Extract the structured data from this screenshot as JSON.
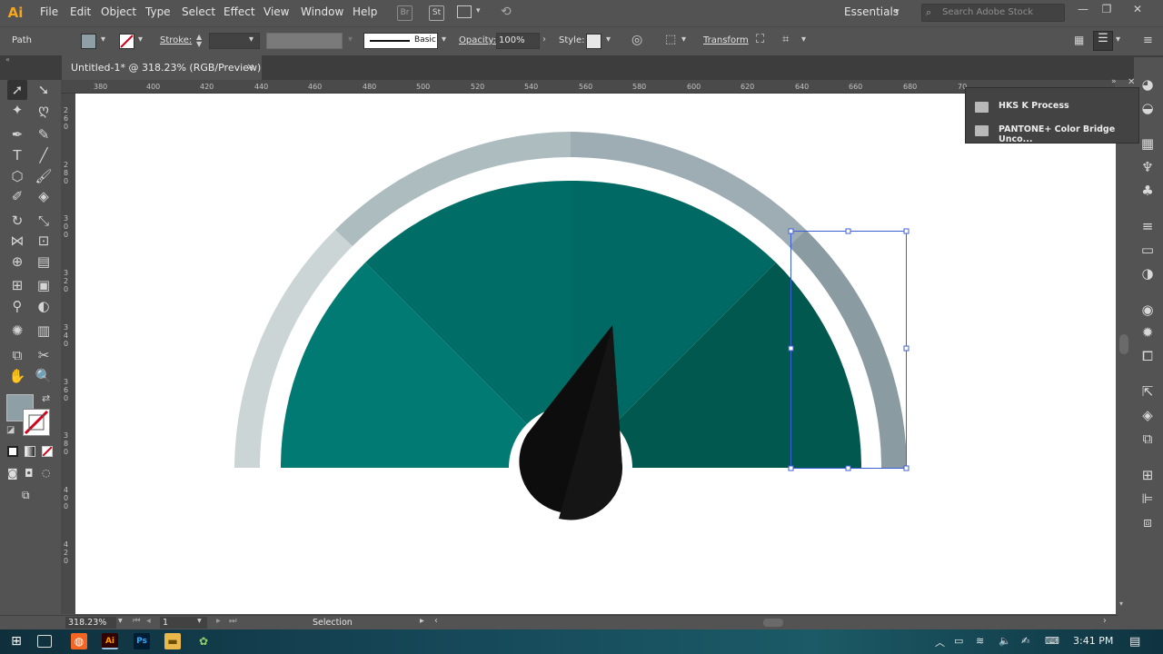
{
  "app": {
    "logo": "Ai"
  },
  "menus": [
    "File",
    "Edit",
    "Object",
    "Type",
    "Select",
    "Effect",
    "View",
    "Window",
    "Help"
  ],
  "menubar_icons": {
    "bridge": "Br",
    "stock": "St"
  },
  "workspace": {
    "label": "Essentials",
    "search_placeholder": "Search Adobe Stock"
  },
  "control": {
    "selection_type": "Path",
    "stroke_label": "Stroke:",
    "brush": "Basic",
    "opacity_label": "Opacity:",
    "opacity_value": "100%",
    "style_label": "Style:",
    "transform": "Transform"
  },
  "document": {
    "tab_title": "Untitled-1* @ 318.23% (RGB/Preview)",
    "close": "×"
  },
  "ruler": {
    "h_ticks": [
      "380",
      "400",
      "420",
      "440",
      "460",
      "480",
      "500",
      "520",
      "540",
      "560",
      "580",
      "600",
      "620",
      "640",
      "660",
      "680",
      "70"
    ],
    "v_ticks": [
      "2\n6\n0",
      "2\n8\n0",
      "3\n0\n0",
      "3\n2\n0",
      "3\n4\n0",
      "3\n6\n0",
      "3\n8\n0",
      "4\n0\n0",
      "4\n2\n0"
    ]
  },
  "swatch_popup": {
    "items": [
      "HKS K Process",
      "PANTONE+ Color Bridge Unco..."
    ]
  },
  "status": {
    "zoom": "318.23%",
    "artboard": "1",
    "tool": "Selection"
  },
  "taskbar": {
    "time": "3:41 PM"
  },
  "colors": {
    "teal_dark": "#00574f",
    "teal_mid": "#006b64",
    "teal_light": "#007a72",
    "ring_light": "#ccd5d5",
    "ring_mid": "#adbcbf",
    "ring_dark": "#8a9ba2",
    "needle": "#111111",
    "selection": "#3d5fd6"
  }
}
